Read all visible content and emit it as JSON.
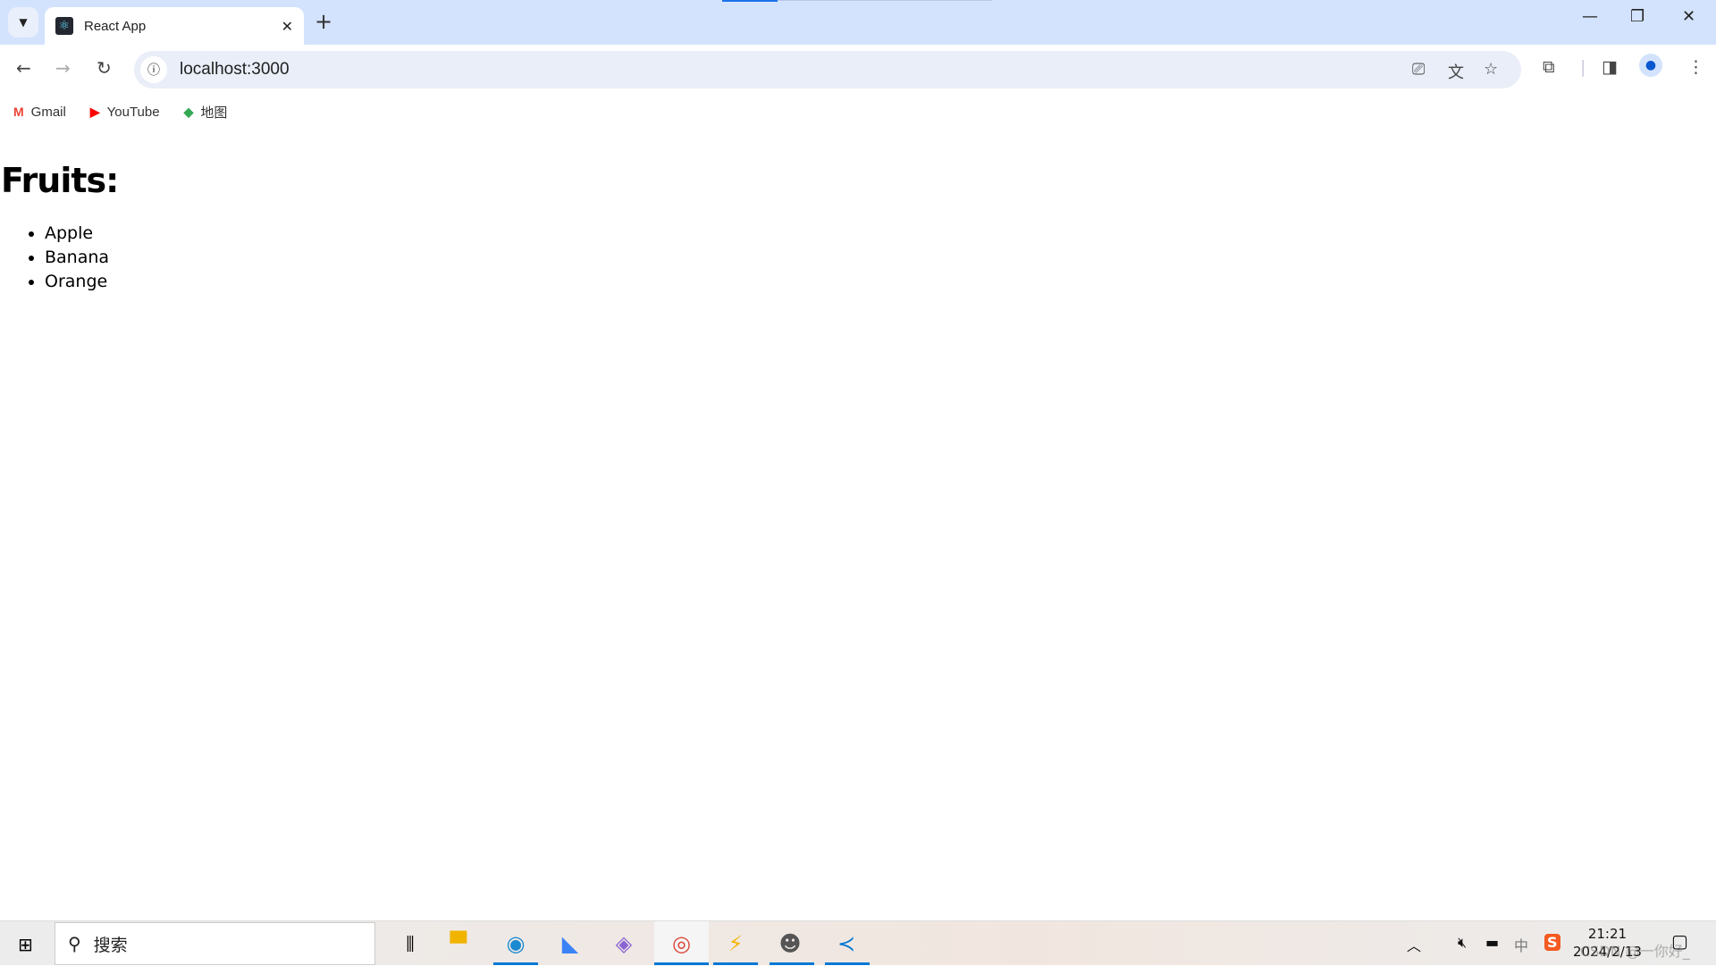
{
  "browser": {
    "tab_title": "React App",
    "url": "localhost:3000",
    "bookmarks": [
      {
        "label": "Gmail",
        "icon": "gmail-icon"
      },
      {
        "label": "YouTube",
        "icon": "youtube-icon"
      },
      {
        "label": "地图",
        "icon": "maps-icon"
      }
    ]
  },
  "page": {
    "heading": "Fruits:",
    "items": [
      "Apple",
      "Banana",
      "Orange"
    ]
  },
  "taskbar": {
    "search_placeholder": "搜索",
    "time": "21:21",
    "date": "2024/2/13",
    "ime": "中",
    "apps": [
      "task-view",
      "file-explorer",
      "edge",
      "feishu",
      "copilot",
      "chrome",
      "app-lightning",
      "user-app",
      "vscode"
    ]
  },
  "watermark": "CSDN @一你好_",
  "colors": {
    "tabbar": "#d3e3fd",
    "accent": "#0078d4",
    "omnibox": "#e9eef8"
  }
}
